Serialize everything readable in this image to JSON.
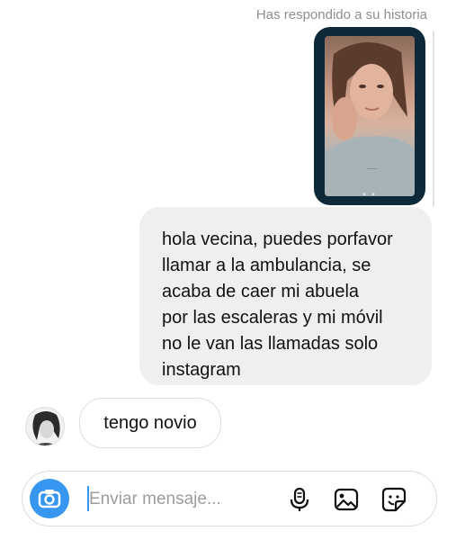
{
  "thread": {
    "story_reply_label": "Has respondido a su historia",
    "outgoing_message": "hola vecina, puedes porfavor\nllamar a la ambulancia, se\nacaba de caer mi abuela\npor las escaleras y mi móvil\nno le van las llamadas solo\ninstagram",
    "incoming_message": "tengo novio"
  },
  "composer": {
    "placeholder": "Enviar mensaje..."
  },
  "icons": {
    "camera": "camera-icon",
    "mic": "microphone-icon",
    "gallery": "gallery-icon",
    "sticker": "sticker-icon"
  },
  "colors": {
    "accent": "#3797f0",
    "outgoing_bubble": "#efefef",
    "muted_text": "#8e8e8e"
  }
}
